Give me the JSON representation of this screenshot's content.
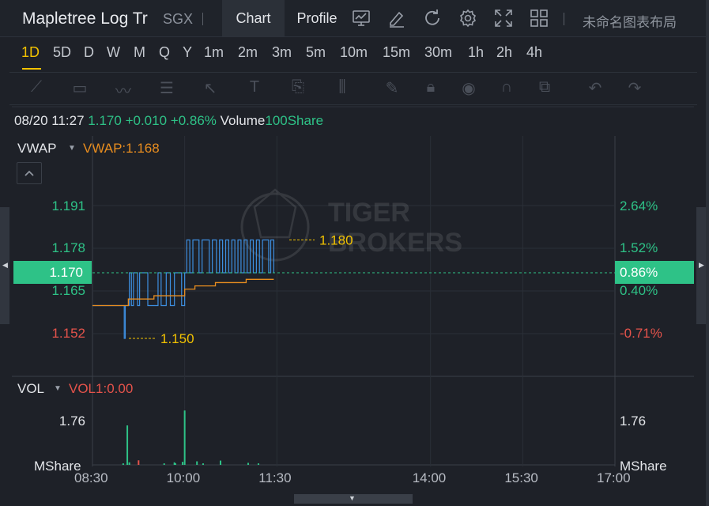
{
  "header": {
    "title": "Mapletree Log Tr",
    "exchange": "SGX",
    "tabs": [
      {
        "label": "Chart",
        "active": true
      },
      {
        "label": "Profile",
        "active": false
      }
    ],
    "icons": [
      "indicator-icon",
      "draw-icon",
      "refresh-icon",
      "settings-icon",
      "fullscreen-icon",
      "layout-grid-icon"
    ],
    "layout_name": "未命名图表布局"
  },
  "periods": [
    "1D",
    "5D",
    "D",
    "W",
    "M",
    "Q",
    "Y",
    "1m",
    "2m",
    "3m",
    "5m",
    "10m",
    "15m",
    "30m",
    "1h",
    "2h",
    "4h"
  ],
  "active_period": "1D",
  "drawing_tools": [
    "line-tool-icon",
    "rectangle-tool-icon",
    "pattern-tool-icon",
    "fib-tool-icon",
    "arrow-tool-icon",
    "text-tool-icon",
    "label-tool-icon",
    "measure-tool-icon",
    "pen-icon",
    "lock-icon",
    "eye-icon",
    "magnet-icon",
    "clone-icon",
    "undo-icon",
    "trash-icon"
  ],
  "info": {
    "datetime": "08/20 11:27",
    "price": "1.170",
    "change": "+0.010",
    "change_pct": "+0.86%",
    "volume_label": "Volume",
    "volume_value": "100Share"
  },
  "indicator": {
    "name": "VWAP",
    "value_label": "VWAP:1.168"
  },
  "price_axis": {
    "labels": [
      {
        "text": "1.191",
        "color": "#2ec287"
      },
      {
        "text": "1.178",
        "color": "#2ec287"
      },
      {
        "text": "1.165",
        "color": "#2ec287"
      },
      {
        "text": "1.152",
        "color": "#e5534b"
      }
    ],
    "current": "1.170",
    "high_label": "1.180",
    "low_label": "1.150"
  },
  "pct_axis": {
    "labels": [
      {
        "text": "2.64%",
        "color": "#2ec287"
      },
      {
        "text": "1.52%",
        "color": "#2ec287"
      },
      {
        "text": "0.40%",
        "color": "#2ec287"
      },
      {
        "text": "-0.71%",
        "color": "#e5534b"
      }
    ],
    "current": "0.86%"
  },
  "volume_panel": {
    "name": "VOL",
    "value_label": "VOL1:0.00",
    "axis_value": "1.76",
    "unit": "MShare"
  },
  "time_axis": [
    "08:30",
    "10:00",
    "11:30",
    "14:00",
    "15:30",
    "17:00"
  ],
  "watermark": "TIGER BROKERS",
  "colors": {
    "up": "#2ec287",
    "down": "#e5534b",
    "vwap": "#e88d1f",
    "price_line": "#3d8fe0",
    "accent": "#f2c200"
  },
  "chart_data": {
    "type": "line",
    "x_range": [
      "08:30",
      "17:00"
    ],
    "ylim": [
      1.145,
      1.198
    ],
    "series": [
      {
        "name": "Price",
        "points": [
          [
            "08:30",
            1.16
          ],
          [
            "09:00",
            1.16
          ],
          [
            "09:01",
            1.15
          ],
          [
            "09:02",
            1.16
          ],
          [
            "09:05",
            1.16
          ],
          [
            "09:06",
            1.17
          ],
          [
            "09:08",
            1.16
          ],
          [
            "09:10",
            1.17
          ],
          [
            "09:14",
            1.16
          ],
          [
            "09:16",
            1.17
          ],
          [
            "09:20",
            1.17
          ],
          [
            "09:24",
            1.16
          ],
          [
            "09:30",
            1.16
          ],
          [
            "09:34",
            1.17
          ],
          [
            "09:37",
            1.16
          ],
          [
            "09:42",
            1.17
          ],
          [
            "09:46",
            1.16
          ],
          [
            "09:50",
            1.17
          ],
          [
            "09:55",
            1.17
          ],
          [
            "09:57",
            1.16
          ],
          [
            "10:00",
            1.17
          ],
          [
            "10:02",
            1.18
          ],
          [
            "10:05",
            1.17
          ],
          [
            "10:08",
            1.18
          ],
          [
            "10:12",
            1.18
          ],
          [
            "10:14",
            1.17
          ],
          [
            "10:17",
            1.18
          ],
          [
            "10:22",
            1.18
          ],
          [
            "10:24",
            1.17
          ],
          [
            "10:27",
            1.18
          ],
          [
            "10:31",
            1.17
          ],
          [
            "10:34",
            1.18
          ],
          [
            "10:37",
            1.17
          ],
          [
            "10:40",
            1.18
          ],
          [
            "10:43",
            1.17
          ],
          [
            "10:46",
            1.18
          ],
          [
            "10:49",
            1.17
          ],
          [
            "10:52",
            1.18
          ],
          [
            "10:55",
            1.17
          ],
          [
            "10:58",
            1.18
          ],
          [
            "11:01",
            1.17
          ],
          [
            "11:04",
            1.18
          ],
          [
            "11:07",
            1.17
          ],
          [
            "11:10",
            1.18
          ],
          [
            "11:13",
            1.17
          ],
          [
            "11:16",
            1.18
          ],
          [
            "11:20",
            1.18
          ],
          [
            "11:22",
            1.17
          ],
          [
            "11:24",
            1.18
          ],
          [
            "11:27",
            1.17
          ]
        ]
      },
      {
        "name": "VWAP",
        "points": [
          [
            "08:30",
            1.16
          ],
          [
            "09:00",
            1.16
          ],
          [
            "09:05",
            1.162
          ],
          [
            "09:20",
            1.162
          ],
          [
            "09:30",
            1.163
          ],
          [
            "09:55",
            1.163
          ],
          [
            "10:00",
            1.165
          ],
          [
            "10:10",
            1.166
          ],
          [
            "10:30",
            1.167
          ],
          [
            "11:00",
            1.168
          ],
          [
            "11:27",
            1.168
          ]
        ]
      }
    ],
    "volume": [
      {
        "t": "09:00",
        "v": 0.06,
        "dir": "up"
      },
      {
        "t": "09:04",
        "v": 1.56,
        "dir": "up"
      },
      {
        "t": "09:06",
        "v": 0.1,
        "dir": "up"
      },
      {
        "t": "09:15",
        "v": 0.18,
        "dir": "down"
      },
      {
        "t": "09:40",
        "v": 0.06,
        "dir": "up"
      },
      {
        "t": "09:50",
        "v": 0.1,
        "dir": "up"
      },
      {
        "t": "09:51",
        "v": 0.06,
        "dir": "up"
      },
      {
        "t": "09:58",
        "v": 0.12,
        "dir": "up"
      },
      {
        "t": "10:00",
        "v": 2.15,
        "dir": "up"
      },
      {
        "t": "10:12",
        "v": 0.14,
        "dir": "up"
      },
      {
        "t": "10:18",
        "v": 0.06,
        "dir": "up"
      },
      {
        "t": "10:35",
        "v": 0.17,
        "dir": "up"
      },
      {
        "t": "11:02",
        "v": 0.08,
        "dir": "up"
      },
      {
        "t": "11:12",
        "v": 0.06,
        "dir": "up"
      }
    ]
  }
}
